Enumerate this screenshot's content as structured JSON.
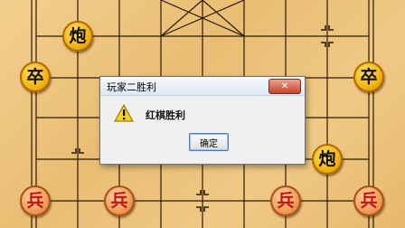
{
  "board": {
    "pieces": [
      {
        "name": "black-cannon-top-left",
        "text": "炮",
        "side": "black"
      },
      {
        "name": "black-soldier-left",
        "text": "卒",
        "side": "black"
      },
      {
        "name": "black-soldier-right",
        "text": "卒",
        "side": "black"
      },
      {
        "name": "black-cannon-right",
        "text": "炮",
        "side": "black"
      },
      {
        "name": "red-pawn-1",
        "text": "兵",
        "side": "red"
      },
      {
        "name": "red-pawn-2",
        "text": "兵",
        "side": "red"
      },
      {
        "name": "red-pawn-3",
        "text": "兵",
        "side": "red"
      },
      {
        "name": "red-pawn-4",
        "text": "兵",
        "side": "red"
      }
    ],
    "colors": {
      "line": "#2a1a0a",
      "red_text": "#c81010",
      "black_text": "#111111"
    }
  },
  "dialog": {
    "title": "玩家二胜利",
    "close_label": "✕",
    "message": "红棋胜利",
    "ok_label": "确定",
    "icon": "warning-icon"
  }
}
